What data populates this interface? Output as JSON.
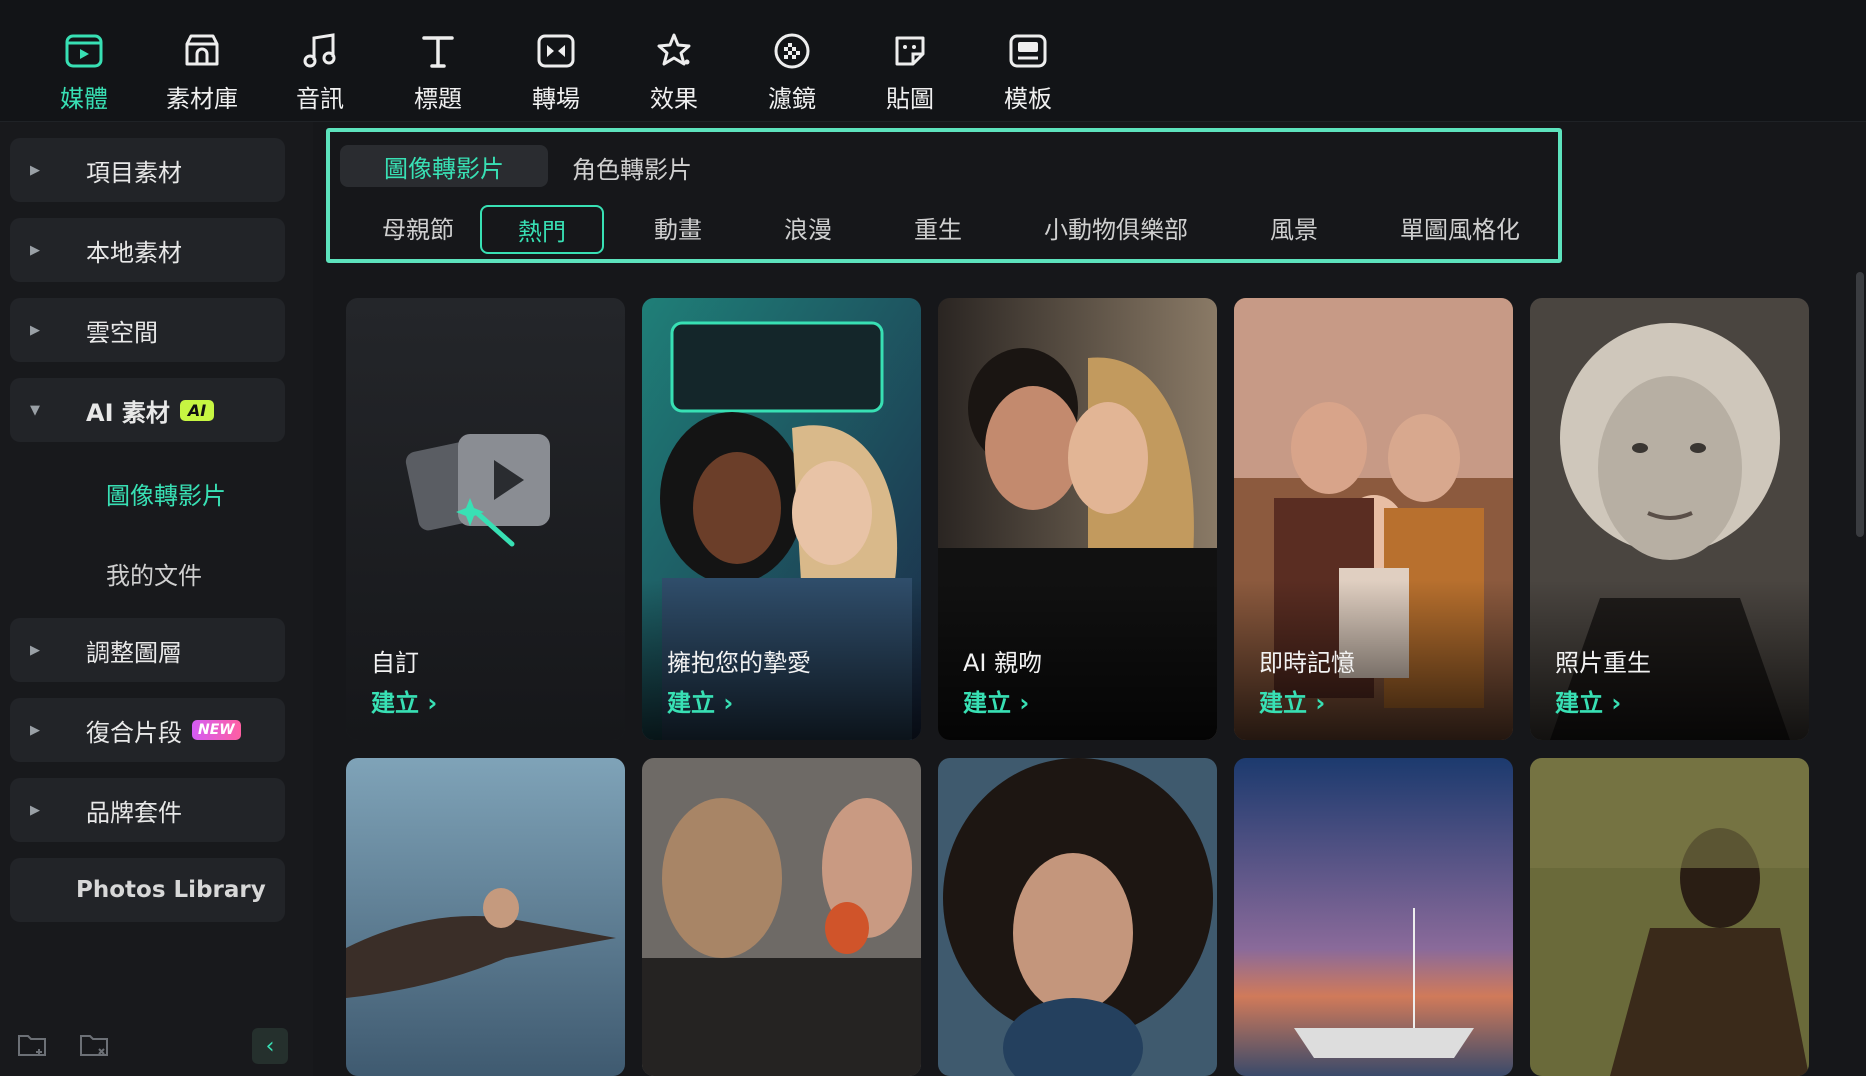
{
  "toolbar": {
    "tabs": [
      {
        "label": "媒體",
        "icon": "media-icon",
        "active": true
      },
      {
        "label": "素材庫",
        "icon": "stock-library-icon",
        "active": false
      },
      {
        "label": "音訊",
        "icon": "music-note-icon",
        "active": false
      },
      {
        "label": "標題",
        "icon": "title-t-icon",
        "active": false
      },
      {
        "label": "轉場",
        "icon": "transition-icon",
        "active": false
      },
      {
        "label": "效果",
        "icon": "effects-star-icon",
        "active": false
      },
      {
        "label": "濾鏡",
        "icon": "filter-icon",
        "active": false
      },
      {
        "label": "貼圖",
        "icon": "sticker-icon",
        "active": false
      },
      {
        "label": "模板",
        "icon": "template-icon",
        "active": false
      }
    ]
  },
  "sidebar": {
    "items": [
      {
        "label": "項目素材",
        "expanded": false
      },
      {
        "label": "本地素材",
        "expanded": false
      },
      {
        "label": "雲空間",
        "expanded": false
      },
      {
        "label": "AI 素材",
        "badge": "AI",
        "expanded": true
      },
      {
        "label": "調整圖層",
        "expanded": false
      },
      {
        "label": "復合片段",
        "badge": "NEW",
        "expanded": false
      },
      {
        "label": "品牌套件",
        "expanded": false
      },
      {
        "label": "Photos Library"
      }
    ],
    "subitems": [
      {
        "label": "圖像轉影片",
        "active": true
      },
      {
        "label": "我的文件",
        "active": false
      }
    ]
  },
  "main": {
    "tabs": [
      {
        "label": "圖像轉影片",
        "active": true
      },
      {
        "label": "角色轉影片",
        "active": false
      }
    ],
    "categories": [
      {
        "label": "母親節",
        "active": false
      },
      {
        "label": "熱門",
        "active": true
      },
      {
        "label": "動畫",
        "active": false
      },
      {
        "label": "浪漫",
        "active": false
      },
      {
        "label": "重生",
        "active": false
      },
      {
        "label": "小動物俱樂部",
        "active": false
      },
      {
        "label": "風景",
        "active": false
      },
      {
        "label": "單圖風格化",
        "active": false
      }
    ],
    "cards": [
      {
        "title": "自訂",
        "action": "建立 ›"
      },
      {
        "title": "擁抱您的摯愛",
        "action": "建立 ›"
      },
      {
        "title": "AI 親吻",
        "action": "建立 ›"
      },
      {
        "title": "即時記憶",
        "action": "建立 ›"
      },
      {
        "title": "照片重生",
        "action": "建立 ›"
      }
    ]
  },
  "colors": {
    "accent": "#38e0b4",
    "highlight_border": "#5de3bd",
    "background": "#16171a"
  }
}
